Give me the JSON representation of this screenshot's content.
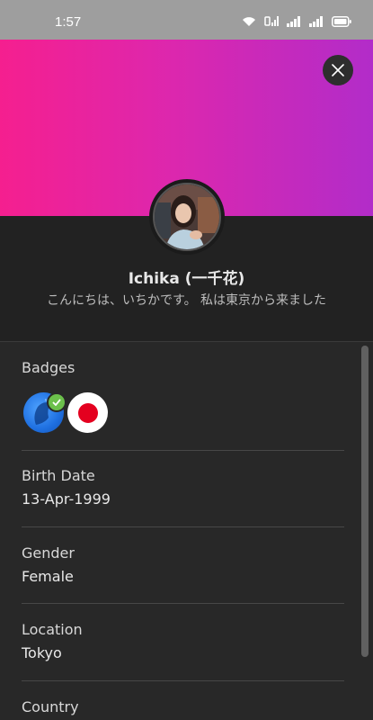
{
  "status_bar": {
    "time": "1:57"
  },
  "profile": {
    "name": "Ichika (一千花)",
    "bio": "こんにちは、いちかです。 私は東京から来ました"
  },
  "sections": {
    "badges": {
      "label": "Badges"
    },
    "birth_date": {
      "label": "Birth Date",
      "value": "13-Apr-1999"
    },
    "gender": {
      "label": "Gender",
      "value": "Female"
    },
    "location": {
      "label": "Location",
      "value": "Tokyo"
    },
    "country": {
      "label": "Country"
    }
  },
  "badges": [
    {
      "icon": "verified-globe-badge-icon",
      "colors": [
        "#1e6fe0",
        "#6bc04b"
      ]
    },
    {
      "icon": "japan-flag-badge-icon",
      "colors": [
        "#ffffff",
        "#e4001f"
      ]
    }
  ],
  "colors": {
    "header_gradient_start": "#f51f8f",
    "header_gradient_end": "#b22cc9",
    "background": "#282828"
  }
}
